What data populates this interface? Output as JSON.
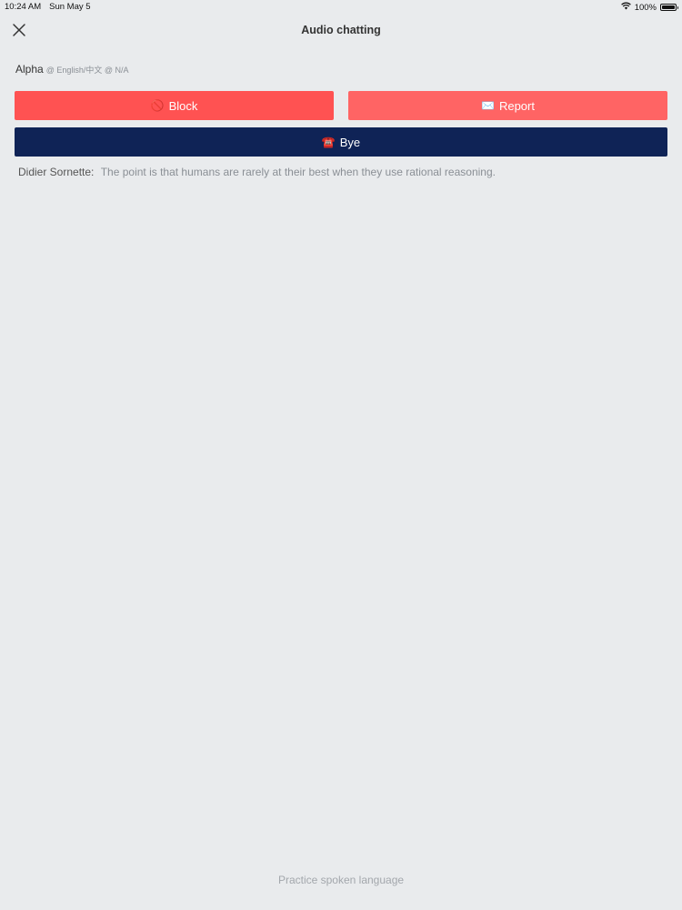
{
  "status_bar": {
    "time": "10:24 AM",
    "date": "Sun May 5",
    "battery": "100%",
    "battery_level": 1.0
  },
  "nav": {
    "title": "Audio chatting",
    "close_icon": "close-icon"
  },
  "user": {
    "name": "Alpha",
    "meta": "@ English/中文 @ N/A"
  },
  "actions": {
    "block_label": "Block",
    "block_icon": "🚫",
    "report_label": "Report",
    "report_icon": "✉️",
    "bye_label": "Bye",
    "bye_icon": "☎️",
    "colors": {
      "block": "#ff5252",
      "report": "#ff6464",
      "bye": "#0f2356"
    }
  },
  "messages": [
    {
      "speaker": "Didier Sornette:",
      "text": "The point is that humans are rarely at their best when they use rational reasoning."
    }
  ],
  "footer": {
    "text": "Practice spoken language"
  }
}
